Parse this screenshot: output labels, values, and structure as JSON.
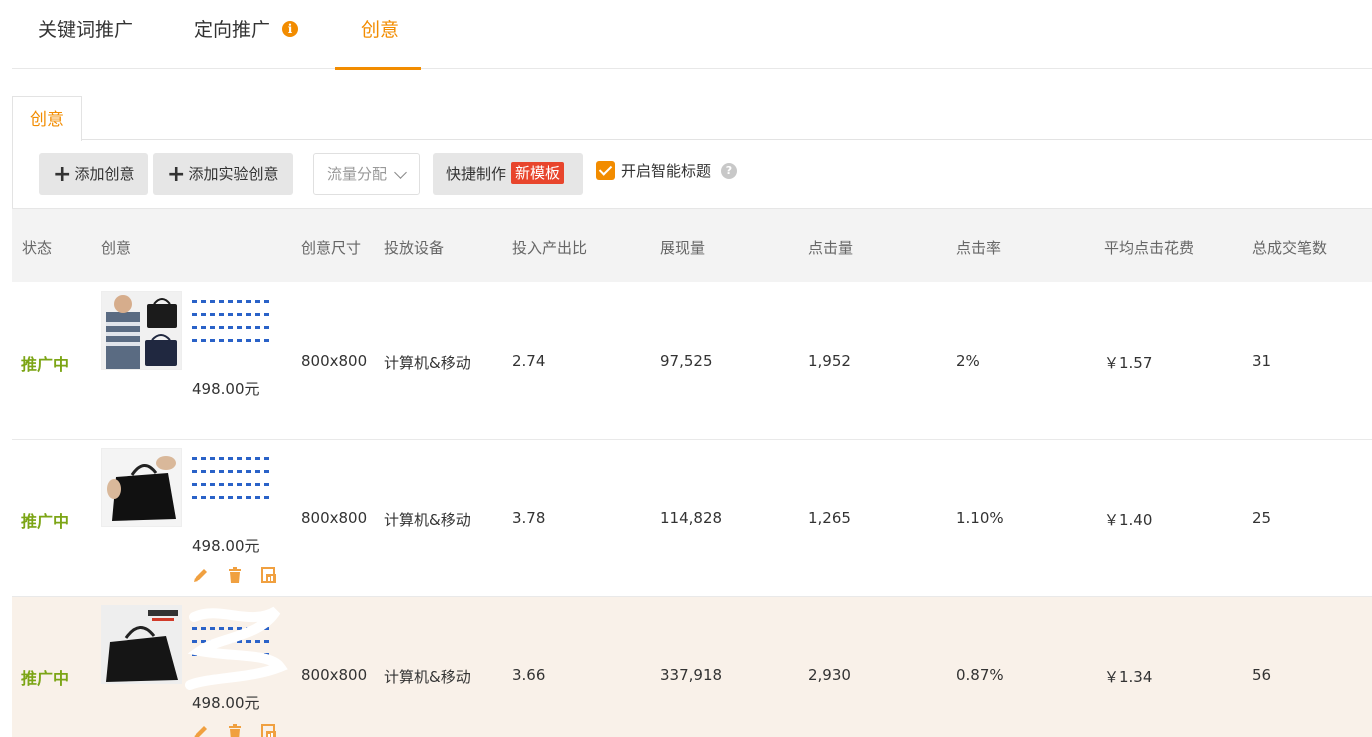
{
  "tabs": [
    {
      "label": "关键词推广",
      "active": false
    },
    {
      "label": "定向推广",
      "active": false,
      "has_info": true
    },
    {
      "label": "创意",
      "active": true
    }
  ],
  "panel_tab": "创意",
  "toolbar": {
    "add_creative": "添加创意",
    "add_experiment": "添加实验创意",
    "traffic_select": "流量分配",
    "quick_make": "快捷制作",
    "new_template_badge": "新模板",
    "smart_title": "开启智能标题",
    "smart_title_checked": true
  },
  "table": {
    "headers": [
      "状态",
      "创意",
      "创意尺寸",
      "投放设备",
      "投入产出比",
      "展现量",
      "点击量",
      "点击率",
      "平均点击花费",
      "总成交笔数"
    ],
    "rows": [
      {
        "status": "推广中",
        "price": "498.00元",
        "size": "800x800",
        "device": "计算机&移动",
        "roi": "2.74",
        "impressions": "97,525",
        "clicks": "1,952",
        "ctr": "2%",
        "cpc": "￥1.57",
        "orders": "31",
        "show_ops": false
      },
      {
        "status": "推广中",
        "price": "498.00元",
        "size": "800x800",
        "device": "计算机&移动",
        "roi": "3.78",
        "impressions": "114,828",
        "clicks": "1,265",
        "ctr": "1.10%",
        "cpc": "￥1.40",
        "orders": "25",
        "show_ops": true
      },
      {
        "status": "推广中",
        "price": "498.00元",
        "size": "800x800",
        "device": "计算机&移动",
        "roi": "3.66",
        "impressions": "337,918",
        "clicks": "2,930",
        "ctr": "0.87%",
        "cpc": "￥1.34",
        "orders": "56",
        "show_ops": true
      }
    ]
  },
  "colors": {
    "accent": "#f28c00",
    "status_active": "#7ca516",
    "link": "#2a62c8",
    "badge": "#e8452c"
  }
}
